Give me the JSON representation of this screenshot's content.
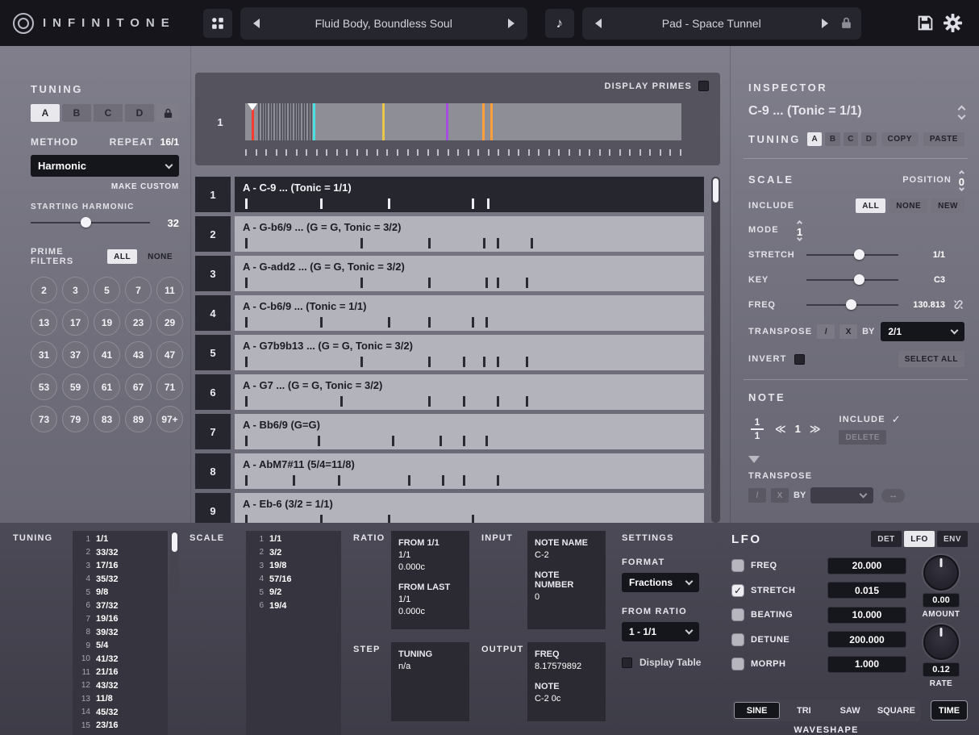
{
  "icons": {
    "music_note": "♪"
  },
  "topbar": {
    "logo_text": "INFINITONE",
    "preset_left": {
      "name": "Fluid Body, Boundless Soul"
    },
    "preset_right": {
      "name": "Pad - Space Tunnel"
    }
  },
  "tuning_panel": {
    "title": "TUNING",
    "tabs": [
      "A",
      "B",
      "C",
      "D"
    ],
    "method_label": "METHOD",
    "repeat_label": "REPEAT",
    "repeat_value": "16/1",
    "method_value": "Harmonic",
    "make_custom_label": "MAKE CUSTOM",
    "starting_harmonic_label": "STARTING HARMONIC",
    "starting_harmonic_value": "32",
    "prime_filters_label": "PRIME FILTERS",
    "all_label": "ALL",
    "none_label": "NONE",
    "primes": [
      "2",
      "3",
      "5",
      "7",
      "11",
      "13",
      "17",
      "19",
      "23",
      "29",
      "31",
      "37",
      "41",
      "43",
      "47",
      "53",
      "59",
      "61",
      "67",
      "71",
      "73",
      "79",
      "83",
      "89",
      "97+"
    ]
  },
  "center": {
    "display_primes_label": "DISPLAY PRIMES",
    "strip_row_number": "1",
    "strip": {
      "comb": {
        "start": 3,
        "end": 15,
        "count": 20
      },
      "lines": [
        {
          "pos": 1.5,
          "color": "#ff3b30",
          "marker": true
        },
        {
          "pos": 15.5,
          "color": "#49e0e0"
        },
        {
          "pos": 31.5,
          "color": "#e8c547"
        },
        {
          "pos": 46.0,
          "color": "#a44fe0"
        },
        {
          "pos": 54.4,
          "color": "#ff9f3b"
        },
        {
          "pos": 56.2,
          "color": "#ff9f3b"
        }
      ],
      "ruler_ticks": 44
    },
    "rows": [
      {
        "num": "1",
        "label": "A - C-9 ... (Tonic = 1/1)",
        "selected": true,
        "ticks": [
          0.5,
          17,
          32,
          50.5,
          54
        ]
      },
      {
        "num": "2",
        "label": "A - G-b6/9 ...  (G = G, Tonic = 3/2)",
        "ticks": [
          0.5,
          26,
          41,
          53,
          56,
          63.5
        ]
      },
      {
        "num": "3",
        "label": "A - G-add2 ...  (G = G, Tonic = 3/2)",
        "ticks": [
          0.5,
          26,
          41,
          53.5,
          56,
          62.5
        ]
      },
      {
        "num": "4",
        "label": "A - C-b6/9 ... (Tonic = 1/1)",
        "ticks": [
          0.5,
          17,
          32,
          41,
          50.5,
          53.5
        ]
      },
      {
        "num": "5",
        "label": "A - G7b9b13 ...  (G = G, Tonic = 3/2)",
        "ticks": [
          0.5,
          26,
          41,
          48.5,
          53,
          56,
          62.5
        ]
      },
      {
        "num": "6",
        "label": "A - G7 ...  (G = G, Tonic = 3/2)",
        "ticks": [
          0.5,
          21.5,
          41,
          48.5,
          56,
          62.5
        ]
      },
      {
        "num": "7",
        "label": "A - Bb6/9 (G=G)",
        "ticks": [
          0.5,
          16.5,
          33,
          43.5,
          48.5,
          53.5
        ]
      },
      {
        "num": "8",
        "label": "A - AbM7#11 (5/4=11/8)",
        "ticks": [
          0.5,
          11,
          21,
          36.5,
          44,
          48.5,
          56
        ]
      },
      {
        "num": "9",
        "label": "A - Eb-6 (3/2 = 1/1)",
        "ticks": [
          0.5,
          17,
          32,
          50.5
        ]
      }
    ]
  },
  "inspector": {
    "title": "INSPECTOR",
    "selection_label": "C-9 ... (Tonic = 1/1)",
    "tuning_label": "TUNING",
    "tuning_tabs": [
      "A",
      "B",
      "C",
      "D"
    ],
    "copy_label": "COPY",
    "paste_label": "PASTE",
    "scale_title": "SCALE",
    "position_label": "POSITION",
    "position_value": "0",
    "include_label": "INCLUDE",
    "all_label": "ALL",
    "none_label": "NONE",
    "new_label": "NEW",
    "mode_label": "MODE",
    "mode_value": "1",
    "stretch_label": "STRETCH",
    "stretch_value": "1/1",
    "key_label": "KEY",
    "key_value": "C3",
    "freq_label": "FREQ",
    "freq_value": "130.813",
    "transpose_label": "TRANSPOSE",
    "divide_label": "/",
    "multiply_label": "X",
    "by_label": "BY",
    "transpose_value": "2/1",
    "invert_label": "INVERT",
    "select_all_label": "SELECT ALL",
    "note_title": "NOTE",
    "note_fraction_num": "1",
    "note_fraction_den": "1",
    "note_prev": "≪",
    "note_index": "1",
    "note_next": "≫",
    "note_include_label": "INCLUDE",
    "note_include_check": "✓",
    "delete_label": "DELETE",
    "note_transpose_label": "TRANSPOSE",
    "note_divide_label": "/",
    "note_multiply_label": "X",
    "note_by_label": "BY",
    "note_swap_label": "↔"
  },
  "bottom": {
    "tuning": {
      "title": "TUNING",
      "items": [
        "1/1",
        "33/32",
        "17/16",
        "35/32",
        "9/8",
        "37/32",
        "19/16",
        "39/32",
        "5/4",
        "41/32",
        "21/16",
        "43/32",
        "11/8",
        "45/32",
        "23/16"
      ]
    },
    "scale": {
      "title": "SCALE",
      "items": [
        "1/1",
        "3/2",
        "19/8",
        "57/16",
        "9/2",
        "19/4"
      ]
    },
    "ratio": {
      "title": "RATIO",
      "from_first_label": "FROM 1/1",
      "from_first_value": "1/1",
      "from_first_cents": "0.000c",
      "from_last_label": "FROM LAST",
      "from_last_value": "1/1",
      "from_last_cents": "0.000c"
    },
    "step": {
      "title": "STEP",
      "row_label": "TUNING",
      "row_value": "n/a"
    },
    "input": {
      "title": "INPUT",
      "note_name_label": "NOTE NAME",
      "note_name_value": "C-2",
      "note_number_label": "NOTE NUMBER",
      "note_number_value": "0"
    },
    "output": {
      "title": "OUTPUT",
      "freq_label": "FREQ",
      "freq_value": "8.17579892",
      "note_label": "NOTE",
      "note_value": "C-2 0c"
    },
    "settings": {
      "title": "SETTINGS",
      "format_label": "FORMAT",
      "format_value": "Fractions",
      "from_ratio_label": "FROM RATIO",
      "from_ratio_value": "1 - 1/1",
      "display_table_label": "Display Table"
    },
    "lfo": {
      "title": "LFO",
      "tabs": [
        "DET",
        "LFO",
        "ENV"
      ],
      "rows": [
        {
          "label": "FREQ",
          "value": "20.000",
          "checked": false
        },
        {
          "label": "STRETCH",
          "value": "0.015",
          "checked": true
        },
        {
          "label": "BEATING",
          "value": "10.000",
          "checked": false
        },
        {
          "label": "DETUNE",
          "value": "200.000",
          "checked": false
        },
        {
          "label": "MORPH",
          "value": "1.000",
          "checked": false
        }
      ],
      "amount_value": "0.00",
      "amount_label": "AMOUNT",
      "rate_value": "0.12",
      "rate_label": "RATE",
      "waveshapes": [
        "SINE",
        "TRI",
        "SAW",
        "SQUARE"
      ],
      "time_label": "TIME",
      "waveshape_label": "WAVESHAPE"
    }
  }
}
